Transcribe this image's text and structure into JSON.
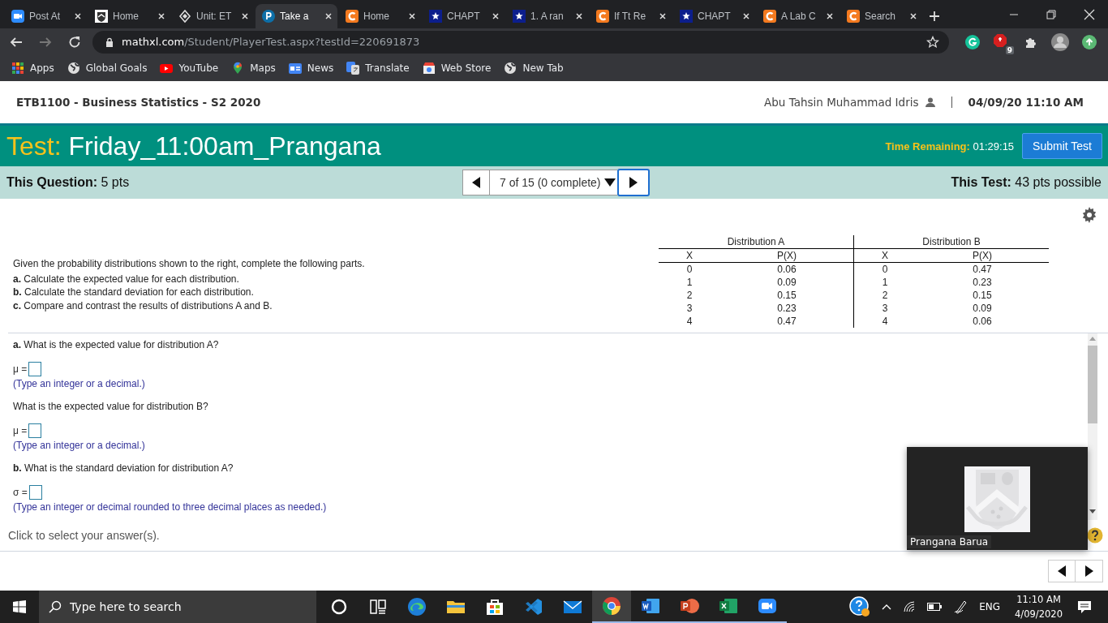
{
  "browser": {
    "tabs": [
      {
        "title": "Post At",
        "kind": "zoom",
        "selected": false
      },
      {
        "title": "Home",
        "kind": "crest",
        "selected": false
      },
      {
        "title": "Unit: ET",
        "kind": "unit",
        "selected": false
      },
      {
        "title": "Take a",
        "kind": "pearson",
        "selected": true
      },
      {
        "title": "Home",
        "kind": "c",
        "selected": false
      },
      {
        "title": "CHAPT",
        "kind": "star",
        "selected": false
      },
      {
        "title": "1. A ran",
        "kind": "star",
        "selected": false
      },
      {
        "title": "If Tt Re",
        "kind": "c",
        "selected": false
      },
      {
        "title": "CHAPT",
        "kind": "star",
        "selected": false
      },
      {
        "title": "A Lab C",
        "kind": "c",
        "selected": false
      },
      {
        "title": "Search",
        "kind": "c",
        "selected": false
      }
    ],
    "address": {
      "host": "mathxl.com",
      "path": "/Student/PlayerTest.aspx?testId=220691873"
    },
    "extension_badge": "9",
    "bookmarks": [
      {
        "label": "Apps",
        "kind": "apps"
      },
      {
        "label": "Global Goals",
        "kind": "globe"
      },
      {
        "label": "YouTube",
        "kind": "play"
      },
      {
        "label": "Maps",
        "kind": "pin"
      },
      {
        "label": "News",
        "kind": "news"
      },
      {
        "label": "Translate",
        "kind": "translate"
      },
      {
        "label": "Web Store",
        "kind": "store"
      },
      {
        "label": "New Tab",
        "kind": "globe"
      }
    ]
  },
  "course_header": {
    "course": "ETB1100 - Business Statistics - S2 2020",
    "user": "Abu Tahsin Muhammad Idris",
    "datetime": "04/09/20 11:10 AM"
  },
  "test_banner": {
    "label": "Test:",
    "name": "Friday_11:00am_Prangana",
    "time_label": "Time Remaining:",
    "time": "01:29:15",
    "submit": "Submit Test"
  },
  "question_bar": {
    "question_label": "This Question:",
    "question_value": "5 pts",
    "position": "7 of 15 (0 complete)",
    "test_label": "This Test:",
    "test_value": "43 pts possible"
  },
  "question": {
    "intro": "Given the probability distributions shown to the right, complete the following parts.",
    "parts": [
      "**a.** Calculate the expected value for each distribution.",
      "**b.** Calculate the standard deviation for each distribution.",
      "**c.** Compare and contrast the results of distributions A and B."
    ]
  },
  "distributions": [
    {
      "title": "Distribution A",
      "columns": [
        "X",
        "P(X)"
      ],
      "rows": [
        [
          "0",
          "0.06"
        ],
        [
          "1",
          "0.09"
        ],
        [
          "2",
          "0.15"
        ],
        [
          "3",
          "0.23"
        ],
        [
          "4",
          "0.47"
        ]
      ]
    },
    {
      "title": "Distribution B",
      "columns": [
        "X",
        "P(X)"
      ],
      "rows": [
        [
          "0",
          "0.47"
        ],
        [
          "1",
          "0.23"
        ],
        [
          "2",
          "0.15"
        ],
        [
          "3",
          "0.09"
        ],
        [
          "4",
          "0.06"
        ]
      ]
    }
  ],
  "answers": [
    {
      "kind": "prompt",
      "text": "**a.** What is the expected value for distribution A?"
    },
    {
      "kind": "field",
      "symbol": "μ ="
    },
    {
      "kind": "hint",
      "text": "(Type an integer or a decimal.)"
    },
    {
      "kind": "prompt",
      "text": "What is the expected value for distribution B?"
    },
    {
      "kind": "field",
      "symbol": "μ ="
    },
    {
      "kind": "hint",
      "text": "(Type an integer or a decimal.)"
    },
    {
      "kind": "prompt",
      "text": "**b.** What is the standard deviation for distribution A?"
    },
    {
      "kind": "field",
      "symbol": "σ ="
    },
    {
      "kind": "hint",
      "text": "(Type an integer or decimal rounded to three decimal places as needed.)"
    }
  ],
  "status": "Click to select your answer(s).",
  "video": {
    "participant": "Prangana Barua"
  },
  "taskbar": {
    "placeholder": "Type here to search",
    "apps": [
      {
        "kind": "cortana",
        "running": false,
        "selected": false
      },
      {
        "kind": "taskview",
        "running": false,
        "selected": false
      },
      {
        "kind": "edge",
        "running": false,
        "selected": false
      },
      {
        "kind": "explorer",
        "running": false,
        "selected": false
      },
      {
        "kind": "store",
        "running": false,
        "selected": false
      },
      {
        "kind": "vscode",
        "running": false,
        "selected": false
      },
      {
        "kind": "mail",
        "running": false,
        "selected": false
      },
      {
        "kind": "chrome",
        "running": true,
        "selected": true
      },
      {
        "kind": "word",
        "running": true,
        "selected": false
      },
      {
        "kind": "powerpoint",
        "running": true,
        "selected": false
      },
      {
        "kind": "excel",
        "running": true,
        "selected": false
      },
      {
        "kind": "zoom",
        "running": true,
        "selected": false
      }
    ],
    "language": "ENG",
    "time": "11:10 AM",
    "date": "4/09/2020"
  }
}
